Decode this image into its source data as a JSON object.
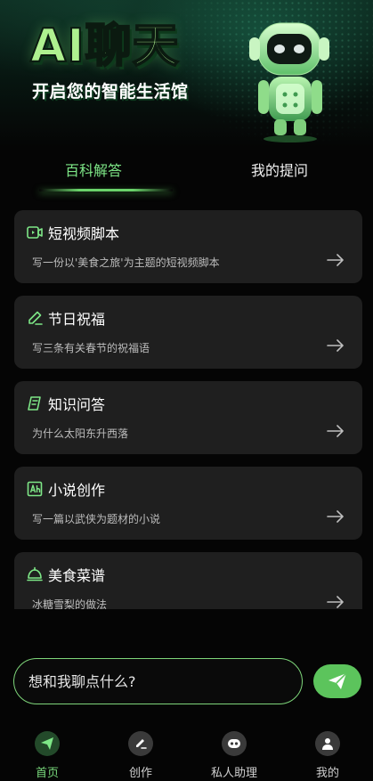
{
  "header": {
    "title": "AI聊天",
    "subtitle": "开启您的智能生活馆"
  },
  "tabs": [
    {
      "label": "百科解答",
      "active": true
    },
    {
      "label": "我的提问",
      "active": false
    }
  ],
  "cards": [
    {
      "icon": "video-icon",
      "title": "短视频脚本",
      "desc": "写一份以'美食之旅'为主题的短视频脚本"
    },
    {
      "icon": "pen-icon",
      "title": "节日祝福",
      "desc": "写三条有关春节的祝福语"
    },
    {
      "icon": "book-icon",
      "title": "知识问答",
      "desc": "为什么太阳东升西落"
    },
    {
      "icon": "novel-icon",
      "title": "小说创作",
      "desc": "写一篇以武侠为题材的小说"
    },
    {
      "icon": "dish-icon",
      "title": "美食菜谱",
      "desc": "冰糖雪梨的做法"
    }
  ],
  "input": {
    "placeholder": "想和我聊点什么?"
  },
  "nav": [
    {
      "label": "首页",
      "icon": "send-icon",
      "active": true
    },
    {
      "label": "创作",
      "icon": "edit-icon",
      "active": false
    },
    {
      "label": "私人助理",
      "icon": "assistant-icon",
      "active": false
    },
    {
      "label": "我的",
      "icon": "user-icon",
      "active": false
    }
  ],
  "colors": {
    "accent": "#7ee787",
    "send_button": "#5cc45c",
    "card_bg": "#1f1f1f",
    "background": "#050505"
  }
}
